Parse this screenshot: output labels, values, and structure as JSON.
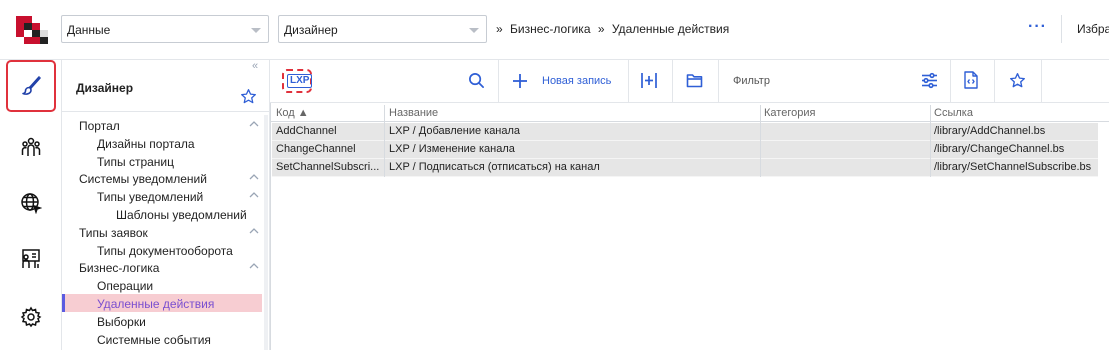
{
  "topbar": {
    "section_select": "Данные",
    "mode_select": "Дизайнер",
    "breadcrumbs": [
      "Бизнес-логика",
      "Удаленные действия"
    ],
    "more_label": "···",
    "favorites_label": "Избра"
  },
  "rail": {
    "items": [
      {
        "name": "designer",
        "icon": "brush-icon",
        "active": true
      },
      {
        "name": "users",
        "icon": "people-icon"
      },
      {
        "name": "web",
        "icon": "globe-icon"
      },
      {
        "name": "presentation",
        "icon": "presenter-icon"
      },
      {
        "name": "settings",
        "icon": "gear-icon"
      }
    ]
  },
  "panel": {
    "title": "Дизайнер",
    "tree": [
      {
        "label": "Портал",
        "level": 0,
        "chevron": true
      },
      {
        "label": "Дизайны портала",
        "level": 1
      },
      {
        "label": "Типы страниц",
        "level": 1
      },
      {
        "label": "Системы уведомлений",
        "level": 0,
        "chevron": true
      },
      {
        "label": "Типы уведомлений",
        "level": 1,
        "chevron": true
      },
      {
        "label": "Шаблоны уведомлений",
        "level": 2
      },
      {
        "label": "Типы заявок",
        "level": 0,
        "chevron": true
      },
      {
        "label": "Типы документооборота",
        "level": 1
      },
      {
        "label": "Бизнес-логика",
        "level": 0,
        "chevron": true
      },
      {
        "label": "Операции",
        "level": 1
      },
      {
        "label": "Удаленные действия",
        "level": 1,
        "selected": true
      },
      {
        "label": "Выборки",
        "level": 1
      },
      {
        "label": "Системные события",
        "level": 1
      }
    ]
  },
  "toolbar": {
    "lxp_badge": "LXP",
    "new_record": "Новая запись",
    "filter": "Фильтр"
  },
  "table": {
    "columns": [
      "Код ▲",
      "Название",
      "Категория",
      "Ссылка"
    ],
    "rows": [
      {
        "code": "AddChannel",
        "name": "LXP / Добавление канала",
        "category": "",
        "link": "/library/AddChannel.bs"
      },
      {
        "code": "ChangeChannel",
        "name": "LXP / Изменение канала",
        "category": "",
        "link": "/library/ChangeChannel.bs"
      },
      {
        "code": "SetChannelSubscri...",
        "name": "LXP / Подписаться (отписаться) на канал",
        "category": "",
        "link": "/library/SetChannelSubscribe.bs"
      }
    ]
  },
  "colors": {
    "accent": "#2f5fd6",
    "highlight_red": "#e0313c",
    "selected_bg": "#f7cdd2",
    "row_bg": "#e6e6e6"
  }
}
